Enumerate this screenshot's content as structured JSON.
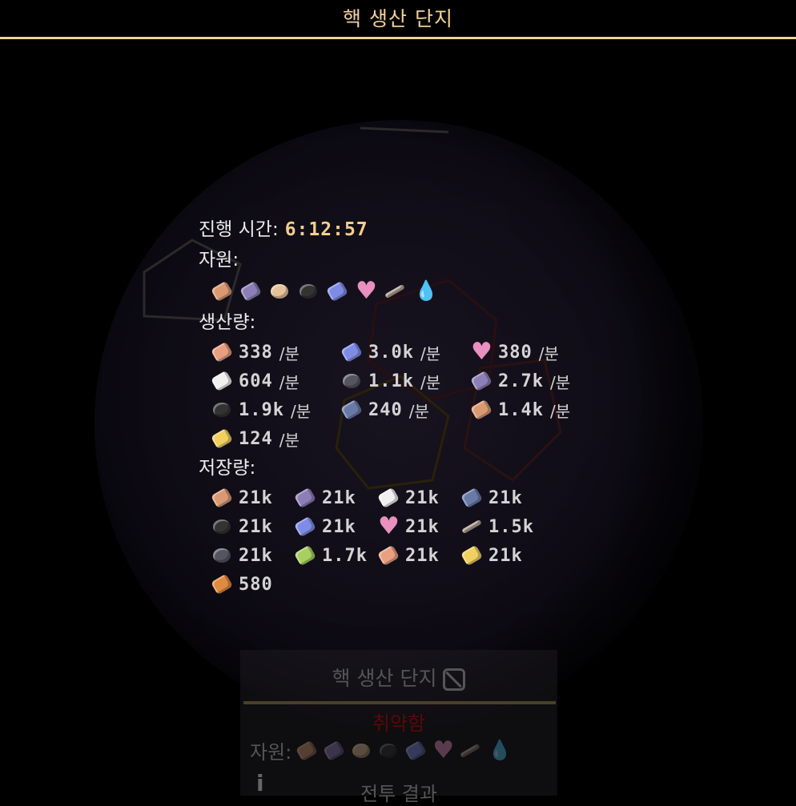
{
  "window": {
    "title": "핵 생산 단지"
  },
  "tooltip": {
    "time_label": "진행 시간:",
    "time_value": "6:12:57",
    "resources_label": "자원:",
    "resource_icons": [
      {
        "icon": "copper-icon",
        "color": "#d99a73"
      },
      {
        "icon": "lead-icon",
        "color": "#8c7fb8"
      },
      {
        "icon": "sand-icon",
        "color": "#e5c29a"
      },
      {
        "icon": "coal-icon",
        "color": "#333333"
      },
      {
        "icon": "titanium-icon",
        "color": "#7f8ce6"
      },
      {
        "icon": "spore-pod-icon",
        "color": "#e890c0"
      },
      {
        "icon": "scrap-icon",
        "color": "#b0a090"
      },
      {
        "icon": "cryofluid-icon",
        "color": "#3a5fd0"
      }
    ],
    "production_label": "생산량:",
    "production": [
      {
        "icon": "plastanium-icon",
        "color": "#e8a080",
        "value": "338",
        "unit": "/분"
      },
      {
        "icon": "titanium-icon",
        "color": "#7f8ce6",
        "value": "3.0k",
        "unit": "/분"
      },
      {
        "icon": "spore-pod-icon",
        "color": "#e890c0",
        "value": "380",
        "unit": "/분"
      },
      {
        "icon": "metaglass-icon",
        "color": "#f0f0f0",
        "value": "604",
        "unit": "/분"
      },
      {
        "icon": "graphite-icon",
        "color": "#555560",
        "value": "1.1k",
        "unit": "/분"
      },
      {
        "icon": "lead-icon",
        "color": "#8c7fb8",
        "value": "2.7k",
        "unit": "/분"
      },
      {
        "icon": "coal-icon",
        "color": "#333333",
        "value": "1.9k",
        "unit": "/분"
      },
      {
        "icon": "silicon-icon",
        "color": "#6a7aa8",
        "value": "240",
        "unit": "/분"
      },
      {
        "icon": "copper-icon",
        "color": "#d99a73",
        "value": "1.4k",
        "unit": "/분"
      },
      {
        "icon": "surge-alloy-icon",
        "color": "#f0d060",
        "value": "124",
        "unit": "/분"
      }
    ],
    "storage_label": "저장량:",
    "storage": [
      {
        "icon": "copper-icon",
        "color": "#d99a73",
        "value": "21k"
      },
      {
        "icon": "lead-icon",
        "color": "#8c7fb8",
        "value": "21k"
      },
      {
        "icon": "metaglass-icon",
        "color": "#f0f0f0",
        "value": "21k"
      },
      {
        "icon": "silicon-icon",
        "color": "#6a7aa8",
        "value": "21k"
      },
      {
        "icon": "coal-icon",
        "color": "#333333",
        "value": "21k"
      },
      {
        "icon": "titanium-icon",
        "color": "#7f8ce6",
        "value": "21k"
      },
      {
        "icon": "spore-pod-icon",
        "color": "#e890c0",
        "value": "21k"
      },
      {
        "icon": "scrap-icon",
        "color": "#b0a090",
        "value": "1.5k"
      },
      {
        "icon": "graphite-icon",
        "color": "#555560",
        "value": "21k"
      },
      {
        "icon": "phase-fabric-icon",
        "color": "#a8d060",
        "value": "1.7k"
      },
      {
        "icon": "plastanium-icon",
        "color": "#e8a080",
        "value": "21k"
      },
      {
        "icon": "surge-alloy-icon",
        "color": "#f0d060",
        "value": "21k"
      },
      {
        "icon": "pyratite-icon",
        "color": "#e08a40",
        "value": "580"
      }
    ]
  },
  "background_panel": {
    "title": "핵 생산 단지",
    "status": "취약함",
    "resources_label": "자원:",
    "battle_results": "전투 결과",
    "info_icon": "i"
  }
}
